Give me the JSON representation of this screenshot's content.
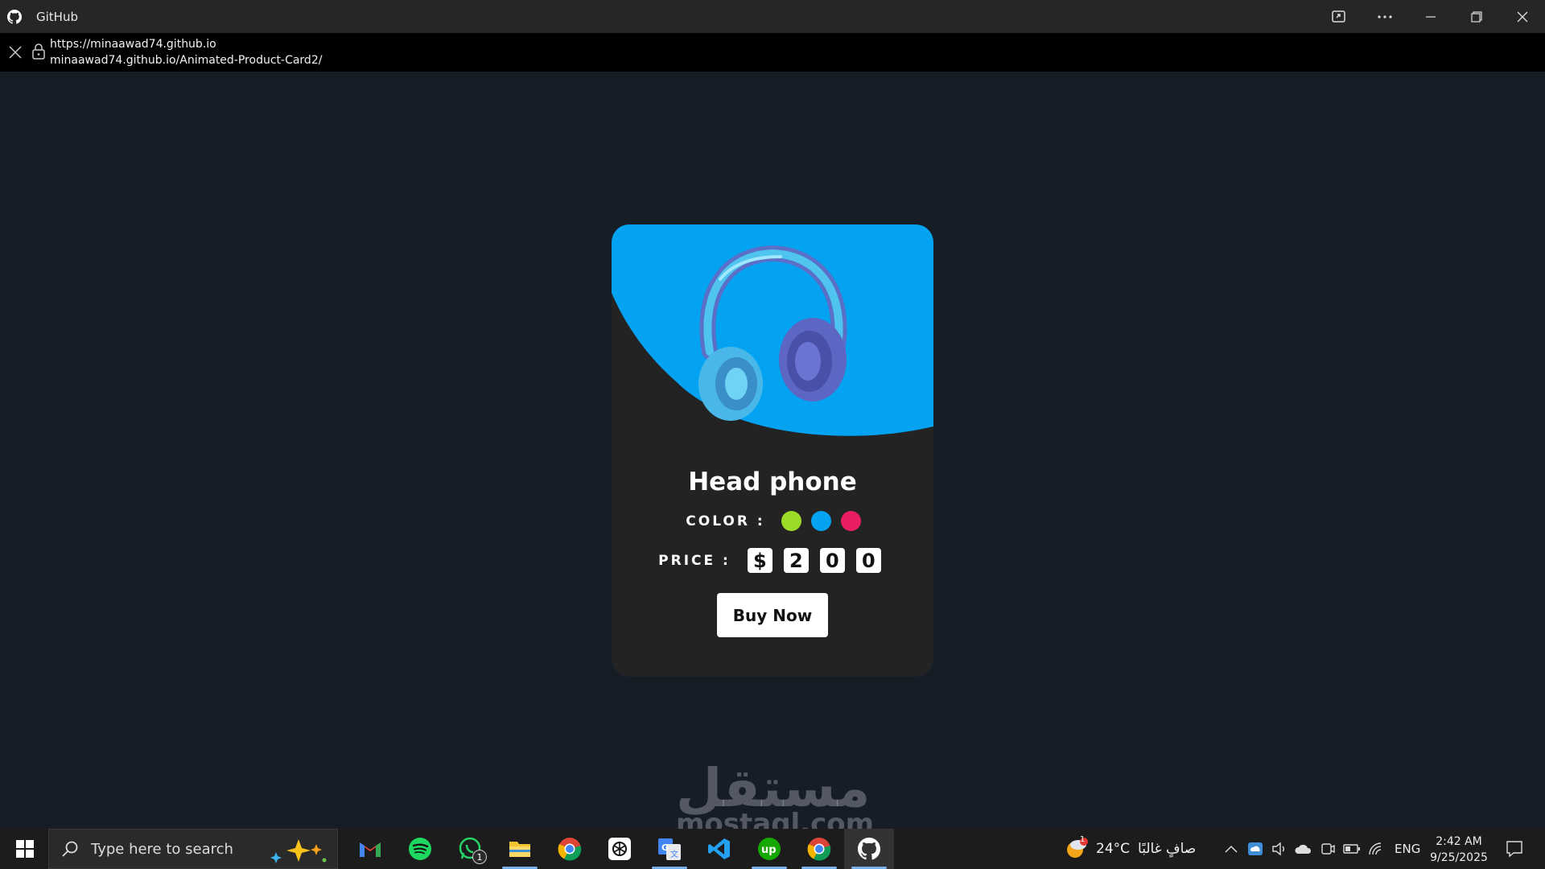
{
  "window": {
    "title": "GitHub",
    "app_icon": "github-icon",
    "controls": [
      "cast-icon",
      "more-icon",
      "minimize-icon",
      "restore-icon",
      "close-icon"
    ]
  },
  "address": {
    "origin": "https://minaawad74.github.io",
    "path": "minaawad74.github.io/Animated-Product-Card2/"
  },
  "card": {
    "accent_color": "#03a3f2",
    "background_color": "#232323",
    "product_name": "Head phone",
    "color_label": "COLOR :",
    "colors": [
      "#9bdc28",
      "#03a3f2",
      "#e91e63"
    ],
    "price_label": "PRICE :",
    "price_digits": [
      "$",
      "2",
      "0",
      "0"
    ],
    "buy_label": "Buy Now"
  },
  "watermark": {
    "arabic": "مستقل",
    "latin": "mostaql.com"
  },
  "taskbar": {
    "search_placeholder": "Type here to search",
    "apps": [
      {
        "name": "gmail-icon"
      },
      {
        "name": "spotify-icon"
      },
      {
        "name": "whatsapp-icon",
        "badge": "1"
      },
      {
        "name": "file-explorer-icon"
      },
      {
        "name": "chrome-icon"
      },
      {
        "name": "chatgpt-icon"
      },
      {
        "name": "google-translate-icon"
      },
      {
        "name": "vscode-icon"
      },
      {
        "name": "upwork-icon"
      },
      {
        "name": "chrome-profile-icon"
      },
      {
        "name": "github-icon"
      }
    ],
    "weather_temp": "24°C",
    "weather_desc": "صافٍ غالبًا",
    "weather_badge": "1",
    "language": "ENG",
    "time": "2:42 AM",
    "date": "9/25/2025"
  }
}
